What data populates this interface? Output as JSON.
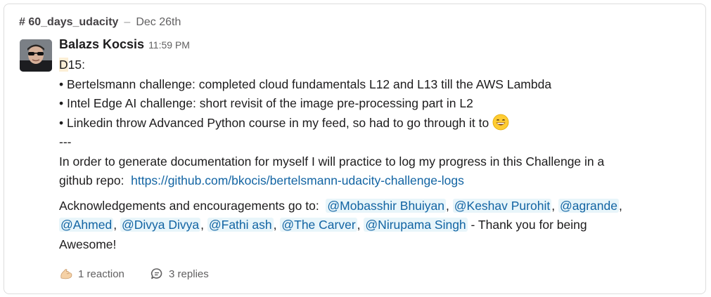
{
  "thread": {
    "channel": "# 60_days_udacity",
    "separator": "–",
    "date": "Dec 26th"
  },
  "message": {
    "author": "Balazs Kocsis",
    "time": "11:59 PM",
    "day_prefix": "D",
    "day_suffix": "15:",
    "bullets": [
      "• Bertelsmann challenge: completed cloud fundamentals L12 and L13 till the AWS Lambda",
      "• Intel Edge AI challenge: short revisit of the image  pre-processing part in L2",
      "• Linkedin throw Advanced Python course in my feed, so had to go through it to"
    ],
    "emoji": "smile-emoji",
    "divider": "---",
    "para1_line1": "In order to generate documentation for myself I will practice to log my progress in this Challenge in a",
    "para1_line2_prefix": "github repo:",
    "link": "https://github.com/bkocis/bertelsmann-udacity-challenge-logs",
    "ack_prefix": "Acknowledgements and encouragements go to:",
    "mentions": [
      "@Mobasshir Bhuiyan",
      "@Keshav Purohit",
      "@agrande",
      "@Ahmed",
      "@Divya Divya",
      "@Fathi ash",
      "@The Carver",
      "@Nirupama Singh"
    ],
    "comma": ",",
    "thanks": "- Thank you for being",
    "thanks_end": "Awesome!"
  },
  "footer": {
    "reaction_icon": "flexed-biceps-icon",
    "reactions": "1 reaction",
    "replies_icon": "comment-bubble-icon",
    "replies": "3 replies"
  },
  "colors": {
    "link": "#1264a3",
    "mention_bg": "#e8f5fa",
    "highlight_bg": "#fcefd6",
    "muted_text": "#616061"
  }
}
